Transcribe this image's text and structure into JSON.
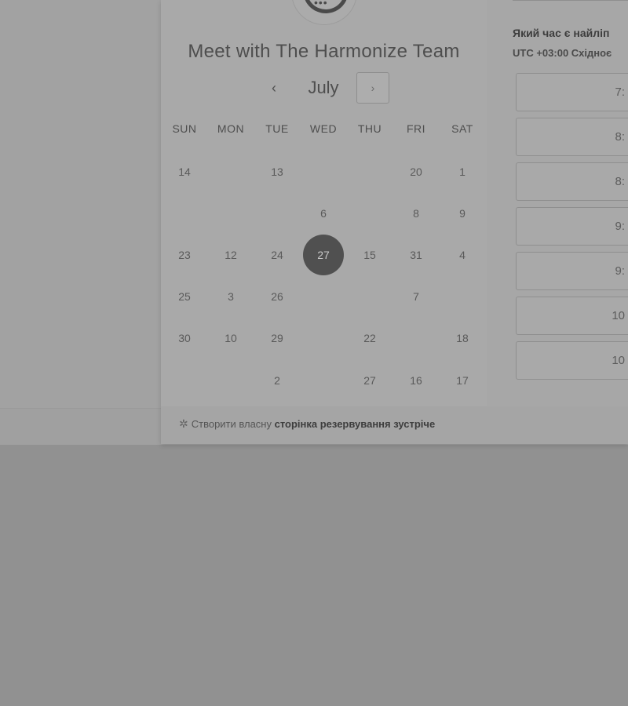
{
  "meeting": {
    "title": "Meet with The Harmonize Team"
  },
  "calendar": {
    "month": "July",
    "prev_icon": "‹",
    "next_icon": "›",
    "weekdays": [
      "SUN",
      "MON",
      "TUE",
      "WED",
      "THU",
      "FRI",
      "SAT"
    ],
    "selected_day": "27",
    "rows": [
      [
        "14",
        "",
        "13",
        "",
        "",
        "20",
        "1"
      ],
      [
        "",
        "",
        "",
        "6",
        "",
        "8",
        "9"
      ],
      [
        "23",
        "12",
        "24",
        "27",
        "15",
        "31",
        "4"
      ],
      [
        "25",
        "3",
        "26",
        "",
        "",
        "7",
        ""
      ],
      [
        "30",
        "10",
        "29",
        "",
        "22",
        "",
        "18"
      ],
      [
        "",
        "",
        "2",
        "",
        "27",
        "16",
        "17"
      ]
    ]
  },
  "times": {
    "question": "Який час є найліп",
    "timezone": "UTC +03:00 Східноє",
    "slots": [
      "7:",
      "8:",
      "8:",
      "9:",
      "9:",
      "10",
      "10"
    ]
  },
  "footer": {
    "icon": "hubspot-sprocket-icon",
    "prefix": "Створити власну",
    "link": "сторінка резервування зустріче"
  }
}
